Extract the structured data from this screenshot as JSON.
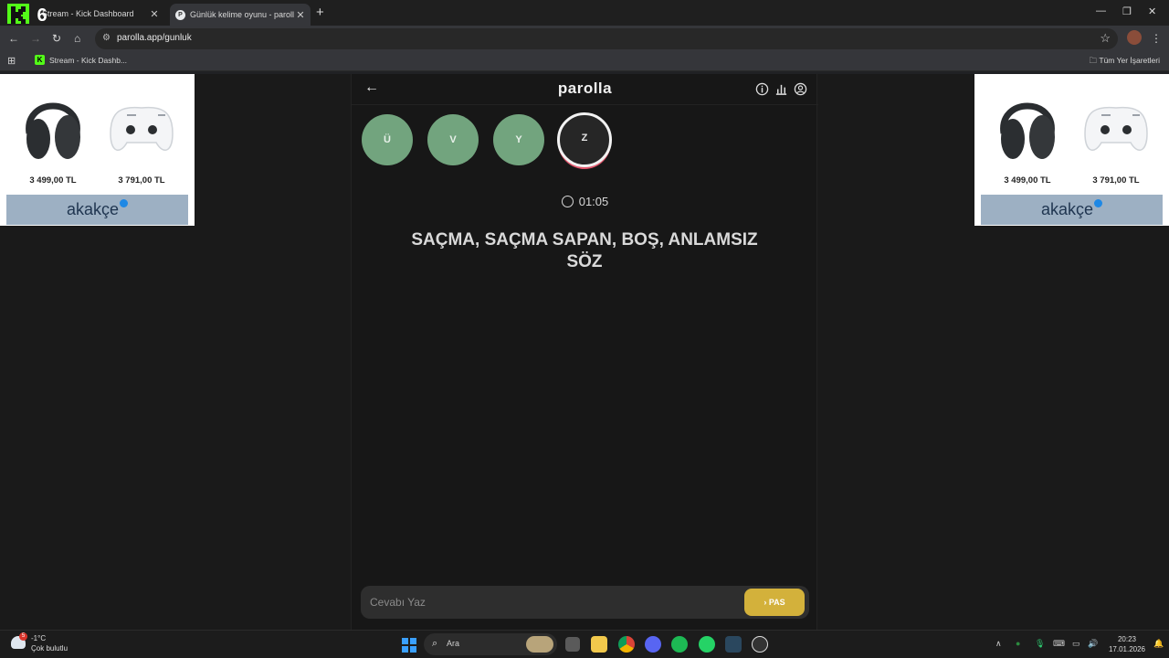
{
  "browser": {
    "tabs": [
      {
        "title": "Stream - Kick Dashboard",
        "active": false
      },
      {
        "title": "Günlük kelime oyunu - parolla",
        "active": true
      }
    ],
    "url": "parolla.app/gunluk",
    "bookmarks": [
      {
        "label": "Stream - Kick Dashb..."
      }
    ],
    "all_bookmarks_label": "Tüm Yer İşaretleri"
  },
  "ads": {
    "products": [
      {
        "name": "headphones",
        "price": "3 499,00 TL"
      },
      {
        "name": "gamepad",
        "price": "3 791,00 TL"
      }
    ],
    "brand": "akakçe"
  },
  "game": {
    "logo": "parolla",
    "letters": [
      {
        "letter": "Ü",
        "state": "done"
      },
      {
        "letter": "V",
        "state": "done"
      },
      {
        "letter": "Y",
        "state": "done"
      },
      {
        "letter": "Z",
        "state": "active"
      }
    ],
    "timer": "01:05",
    "question": "SAÇMA, SAÇMA SAPAN, BOŞ, ANLAMSIZ SÖZ",
    "answer_placeholder": "Cevabı Yaz",
    "pass_label": "PAS",
    "colors": {
      "done": "#72a47e",
      "pass": "#d3b13b",
      "active_ring": "#e0556b"
    }
  },
  "taskbar": {
    "weather_temp": "-1°C",
    "weather_condition": "Çok bulutlu",
    "weather_badge": "5",
    "search_label": "Ara",
    "time": "20:23",
    "date": "17.01.2026"
  }
}
